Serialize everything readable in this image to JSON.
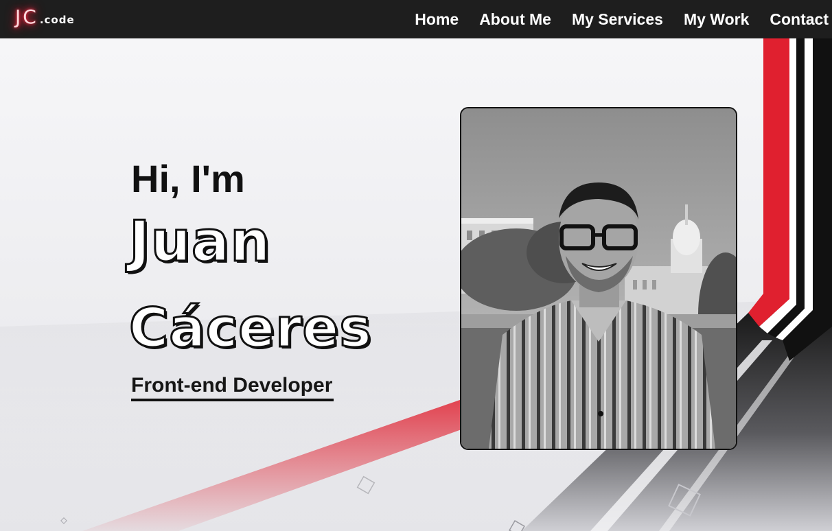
{
  "logo": {
    "main": "JC",
    "suffix": ".code"
  },
  "nav": {
    "items": [
      {
        "label": "Home"
      },
      {
        "label": "About Me"
      },
      {
        "label": "My Services"
      },
      {
        "label": "My Work"
      },
      {
        "label": "Contact"
      }
    ]
  },
  "hero": {
    "greeting": "Hi, I'm",
    "first_name": "Juan",
    "last_name": "Cáceres",
    "role": "Front-end Developer"
  },
  "colors": {
    "navbar": "#1e1e1e",
    "accent_red": "#e0202f",
    "text_dark": "#111111"
  },
  "photo": {
    "icon": "profile-photo",
    "style": "grayscale"
  }
}
